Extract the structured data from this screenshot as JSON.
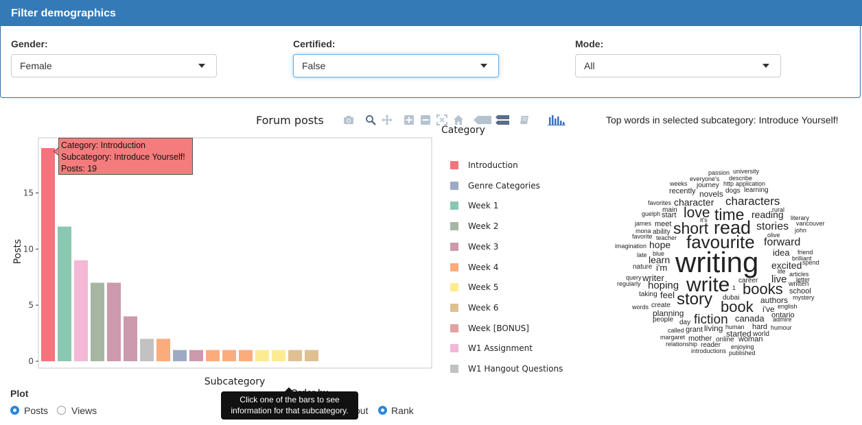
{
  "filter": {
    "title": "Filter demographics",
    "gender": {
      "label": "Gender:",
      "value": "Female"
    },
    "certified": {
      "label": "Certified:",
      "value": "False"
    },
    "mode": {
      "label": "Mode:",
      "value": "All"
    }
  },
  "modebar_icons": [
    "camera-icon",
    "zoom-icon",
    "pan-icon",
    "zoom-in-icon",
    "zoom-out-icon",
    "autoscale-icon",
    "reset-axes-icon",
    "show-closest-icon",
    "compare-data-icon",
    "toggle-spikelines-icon",
    "plotly-logo-icon"
  ],
  "chart_data": {
    "type": "bar",
    "title": "Forum posts",
    "xlabel": "Subcategory",
    "ylabel": "Posts",
    "ylim": [
      0,
      19.5
    ],
    "yticks": [
      0,
      5,
      10,
      15
    ],
    "legend_title": "Category",
    "legend_position": "right",
    "bars": [
      {
        "category": "Introduction",
        "value": 19
      },
      {
        "category": "Week 1",
        "value": 12
      },
      {
        "category": "W1 Assignment",
        "value": 9
      },
      {
        "category": "Week 2",
        "value": 7
      },
      {
        "category": "Week 3",
        "value": 7
      },
      {
        "category": "Week 3",
        "value": 4
      },
      {
        "category": "W1 Hangout Questions",
        "value": 2
      },
      {
        "category": "Week 4",
        "value": 2
      },
      {
        "category": "Genre Categories",
        "value": 1
      },
      {
        "category": "Week 3",
        "value": 1
      },
      {
        "category": "Week 4",
        "value": 1
      },
      {
        "category": "Week 4",
        "value": 1
      },
      {
        "category": "Week 4",
        "value": 1
      },
      {
        "category": "Week 5",
        "value": 1
      },
      {
        "category": "Week 5",
        "value": 1
      },
      {
        "category": "Week 6",
        "value": 1
      },
      {
        "category": "Week 6",
        "value": 1
      }
    ],
    "categories": [
      {
        "name": "Introduction",
        "color": "#f4737d"
      },
      {
        "name": "Genre Categories",
        "color": "#9eaac5"
      },
      {
        "name": "Week 1",
        "color": "#8ac7b1"
      },
      {
        "name": "Week 2",
        "color": "#a6b6a2"
      },
      {
        "name": "Week 3",
        "color": "#cc99ad"
      },
      {
        "name": "Week 4",
        "color": "#fcab7c"
      },
      {
        "name": "Week 5",
        "color": "#fdeb93"
      },
      {
        "name": "Week 6",
        "color": "#dfc091"
      },
      {
        "name": "Week [BONUS]",
        "color": "#e0a3a3"
      },
      {
        "name": "W1 Assignment",
        "color": "#f2b8d5"
      },
      {
        "name": "W1 Hangout Questions",
        "color": "#c2c2c2"
      }
    ]
  },
  "tooltip": {
    "line1": "Category: Introduction",
    "line2": "Subcategory: Introduce Yourself!",
    "line3": "Posts: 19"
  },
  "wordcloud": {
    "title": "Top words in selected subcategory: Introduce Yourself!"
  },
  "controls": {
    "plot_label": "Plot",
    "posts_label": "Posts",
    "views_label": "Views",
    "orderby_label": "Order by",
    "about_label": "out",
    "rank_label": "Rank",
    "hint": "Click one of the bars to see information for that subcategory."
  }
}
